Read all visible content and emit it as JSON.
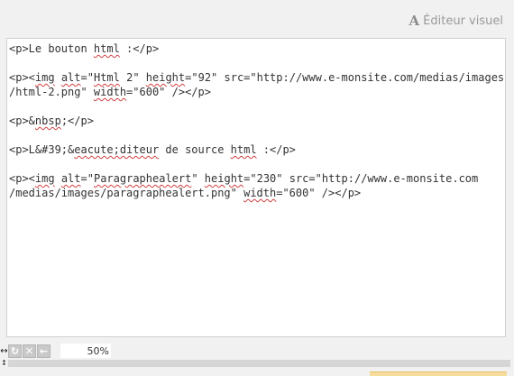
{
  "header": {
    "visual_editor_label": "Éditeur visuel",
    "visual_editor_icon": "A"
  },
  "editor": {
    "lines": [
      [
        {
          "t": "<p>Le bouton "
        },
        {
          "t": "html",
          "s": 1
        },
        {
          "t": " :</p>"
        }
      ],
      [],
      [
        {
          "t": "<p><"
        },
        {
          "t": "img",
          "s": 1
        },
        {
          "t": " "
        },
        {
          "t": "alt",
          "s": 1
        },
        {
          "t": "=\""
        },
        {
          "t": "Html",
          "s": 1
        },
        {
          "t": " 2\" "
        },
        {
          "t": "height",
          "s": 1
        },
        {
          "t": "=\"92\" src=\"http://www.e-monsite.com/medias/images"
        }
      ],
      [
        {
          "t": "/html-2.png\" "
        },
        {
          "t": "width",
          "s": 1
        },
        {
          "t": "=\"600\" /></p>"
        }
      ],
      [],
      [
        {
          "t": "<p>&"
        },
        {
          "t": "nbsp",
          "s": 1
        },
        {
          "t": ";</p>"
        }
      ],
      [],
      [
        {
          "t": "<p>L&#39;&"
        },
        {
          "t": "eacute;diteur",
          "s": 1
        },
        {
          "t": " de source "
        },
        {
          "t": "html",
          "s": 1
        },
        {
          "t": " :</p>"
        }
      ],
      [],
      [
        {
          "t": "<p><"
        },
        {
          "t": "img",
          "s": 1
        },
        {
          "t": " "
        },
        {
          "t": "alt",
          "s": 1
        },
        {
          "t": "=\""
        },
        {
          "t": "Paragraphealert",
          "s": 1
        },
        {
          "t": "\" "
        },
        {
          "t": "height",
          "s": 1
        },
        {
          "t": "=\"230\" src=\"http://www.e-monsite.com"
        }
      ],
      [
        {
          "t": "/medias/images/paragraphealert.png\" "
        },
        {
          "t": "width",
          "s": 1
        },
        {
          "t": "=\"600\" /></p>"
        }
      ]
    ]
  },
  "toolbar": {
    "zoom": "50%",
    "buttons": [
      {
        "name": "refresh-icon",
        "glyph": "↻"
      },
      {
        "name": "close-icon",
        "glyph": "✕"
      },
      {
        "name": "arrow-left-icon",
        "glyph": "←"
      }
    ]
  }
}
